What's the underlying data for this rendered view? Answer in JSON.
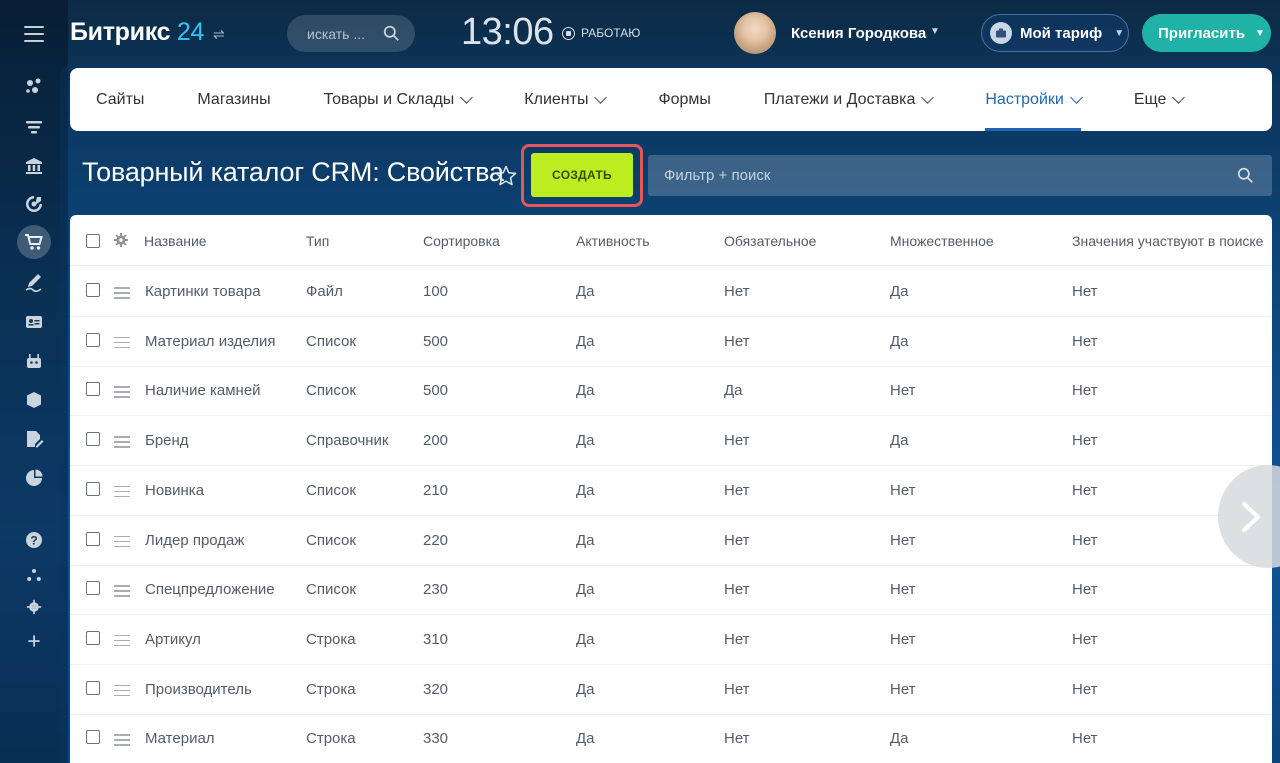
{
  "header": {
    "brand_name": "Битрикс",
    "brand_num": "24",
    "search_placeholder": "искать ...",
    "clock": "13:06",
    "work_status": "РАБОТАЮ",
    "user_name": "Ксения Городкова",
    "tariff_label": "Мой тариф",
    "invite_label": "Пригласить"
  },
  "tabs": [
    {
      "label": "Сайты",
      "dropdown": false
    },
    {
      "label": "Магазины",
      "dropdown": false
    },
    {
      "label": "Товары и Склады",
      "dropdown": true
    },
    {
      "label": "Клиенты",
      "dropdown": true
    },
    {
      "label": "Формы",
      "dropdown": false
    },
    {
      "label": "Платежи и Доставка",
      "dropdown": true
    },
    {
      "label": "Настройки",
      "dropdown": true,
      "active": true
    },
    {
      "label": "Еще",
      "dropdown": true
    }
  ],
  "page": {
    "title": "Товарный каталог CRM: Свойства",
    "create_label": "СОЗДАТЬ",
    "filter_placeholder": "Фильтр + поиск"
  },
  "grid": {
    "columns": [
      "Название",
      "Тип",
      "Сортировка",
      "Активность",
      "Обязательное",
      "Множественное",
      "Значения участвуют в поиске"
    ],
    "rows": [
      [
        "Картинки товара",
        "Файл",
        "100",
        "Да",
        "Нет",
        "Да",
        "Нет"
      ],
      [
        "Материал изделия",
        "Список",
        "500",
        "Да",
        "Нет",
        "Да",
        "Нет"
      ],
      [
        "Наличие камней",
        "Список",
        "500",
        "Да",
        "Да",
        "Нет",
        "Нет"
      ],
      [
        "Бренд",
        "Справочник",
        "200",
        "Да",
        "Нет",
        "Да",
        "Нет"
      ],
      [
        "Новинка",
        "Список",
        "210",
        "Да",
        "Нет",
        "Нет",
        "Нет"
      ],
      [
        "Лидер продаж",
        "Список",
        "220",
        "Да",
        "Нет",
        "Нет",
        "Нет"
      ],
      [
        "Спецпредложение",
        "Список",
        "230",
        "Да",
        "Нет",
        "Нет",
        "Нет"
      ],
      [
        "Артикул",
        "Строка",
        "310",
        "Да",
        "Нет",
        "Нет",
        "Нет"
      ],
      [
        "Производитель",
        "Строка",
        "320",
        "Да",
        "Нет",
        "Нет",
        "Нет"
      ],
      [
        "Материал",
        "Строка",
        "330",
        "Да",
        "Нет",
        "Да",
        "Нет"
      ]
    ]
  },
  "colors": {
    "accent_blue": "#2067b0",
    "create_green": "#bbed21",
    "invite_teal": "#1eb3a6",
    "highlight_red": "#e4565a"
  },
  "icons": {
    "sidebar": [
      "menu-icon",
      "feed-icon",
      "tasks-icon",
      "bank-icon",
      "target-icon",
      "cart-icon",
      "signature-icon",
      "contact-card-icon",
      "robot-icon",
      "box-icon",
      "document-edit-icon",
      "pie-chart-icon",
      "help-icon",
      "structure-icon",
      "gear-icon",
      "plus-icon"
    ]
  }
}
